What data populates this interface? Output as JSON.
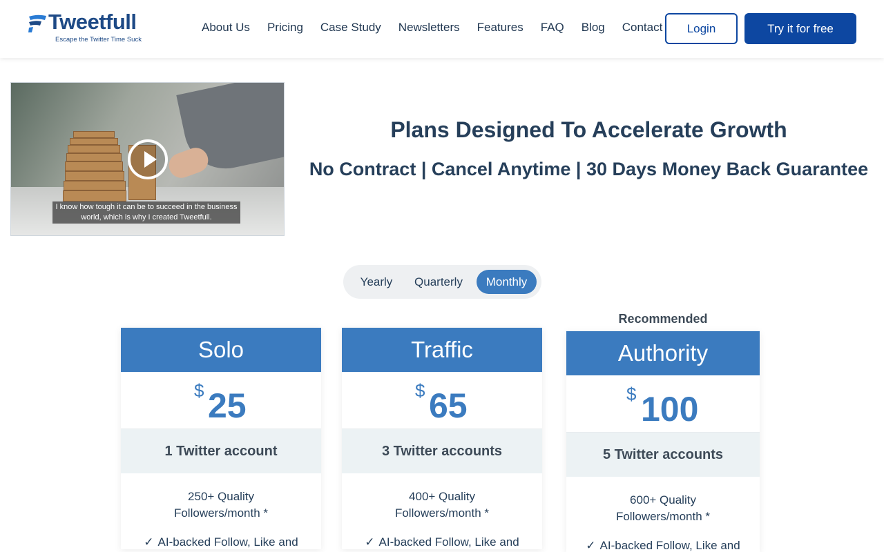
{
  "brand": {
    "name": "Tweetfull",
    "tagline": "Escape the Twitter Time Suck",
    "color": "#1e4a86"
  },
  "nav": {
    "items": [
      "About Us",
      "Pricing",
      "Case Study",
      "Newsletters",
      "Features",
      "FAQ",
      "Blog",
      "Contact"
    ],
    "login_label": "Login",
    "try_label": "Try it for free"
  },
  "video": {
    "caption": "I know how tough it can be to succeed in the business world, which is why I created Tweetfull."
  },
  "hero": {
    "title": "Plans Designed To Accelerate Growth",
    "subtitle": "No Contract | Cancel Anytime | 30 Days Money Back Guarantee"
  },
  "billing_toggle": {
    "options": [
      "Yearly",
      "Quarterly",
      "Monthly"
    ],
    "selected": "Monthly"
  },
  "plans": [
    {
      "name": "Solo",
      "currency": "$",
      "price": "25",
      "accounts": "1 Twitter account",
      "followers_line1": "250+ Quality",
      "followers_line2": "Followers/month *",
      "feature_check": "✓",
      "feature": "AI-backed Follow, Like and"
    },
    {
      "name": "Traffic",
      "currency": "$",
      "price": "65",
      "accounts": "3 Twitter accounts",
      "followers_line1": "400+ Quality",
      "followers_line2": "Followers/month *",
      "feature_check": "✓",
      "feature": "AI-backed Follow, Like and"
    },
    {
      "name": "Authority",
      "currency": "$",
      "price": "100",
      "accounts": "5 Twitter accounts",
      "followers_line1": "600+ Quality",
      "followers_line2": "Followers/month *",
      "feature_check": "✓",
      "feature": "AI-backed Follow, Like and"
    }
  ],
  "recommended_label": "Recommended",
  "colors": {
    "primary": "#0d47a1",
    "accent": "#3b7bbf",
    "heading": "#263f5a",
    "muted_band": "#ecf2f4"
  }
}
